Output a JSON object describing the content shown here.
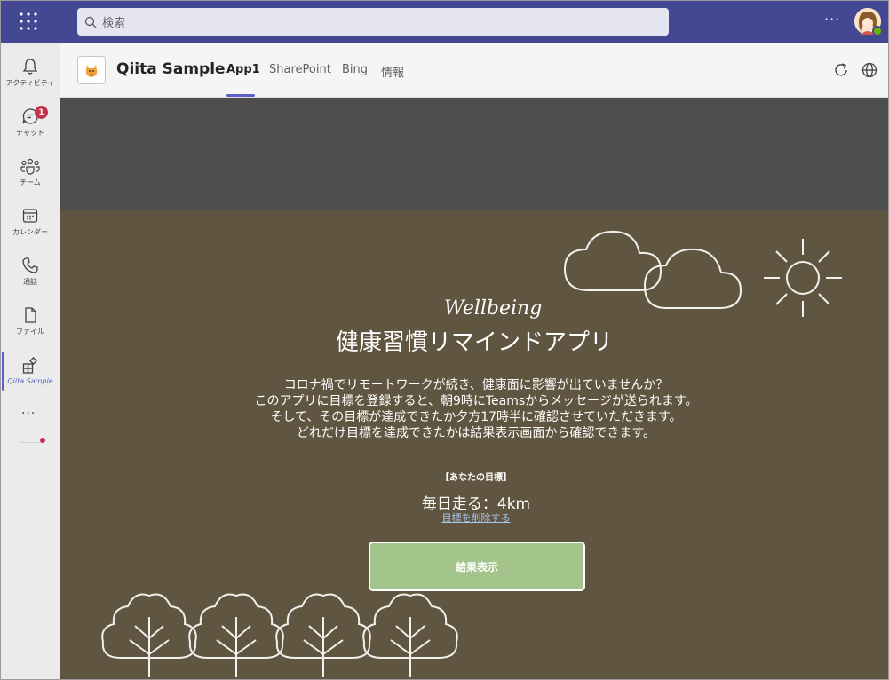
{
  "topbar": {
    "search_placeholder": "検索",
    "more": "···"
  },
  "rail": {
    "items": [
      {
        "label": "アクティビティ"
      },
      {
        "label": "チャット",
        "badge": "1"
      },
      {
        "label": "チーム"
      },
      {
        "label": "カレンダー"
      },
      {
        "label": "通話"
      },
      {
        "label": "ファイル"
      },
      {
        "label": "Qiita Sample"
      }
    ],
    "more": "···"
  },
  "app": {
    "title": "Qiita Sample",
    "tabs": [
      {
        "label": "App1"
      },
      {
        "label": "SharePoint"
      },
      {
        "label": "Bing"
      },
      {
        "label": "情報"
      }
    ]
  },
  "content": {
    "script_title": "Wellbeing",
    "title": "健康習慣リマインドアプリ",
    "description": [
      "コロナ禍でリモートワークが続き、健康面に影響が出ていませんか？",
      "このアプリに目標を登録すると、朝9時にTeamsからメッセージが送られます。",
      "そして、その目標が達成できたか夕方17時半に確認させていただきます。",
      "どれだけ目標を達成できたかは結果表示画面から確認できます。"
    ],
    "goal_label": "【あなたの目標】",
    "goal_value": "毎日走る：4km",
    "goal_delete": "目標を削除する",
    "result_button": "結果表示"
  },
  "colors": {
    "topbar": "#444791",
    "accent": "#5b5fc7",
    "content_bg": "#605540",
    "button_bg": "#a3c48b",
    "badge": "#c4314b"
  }
}
